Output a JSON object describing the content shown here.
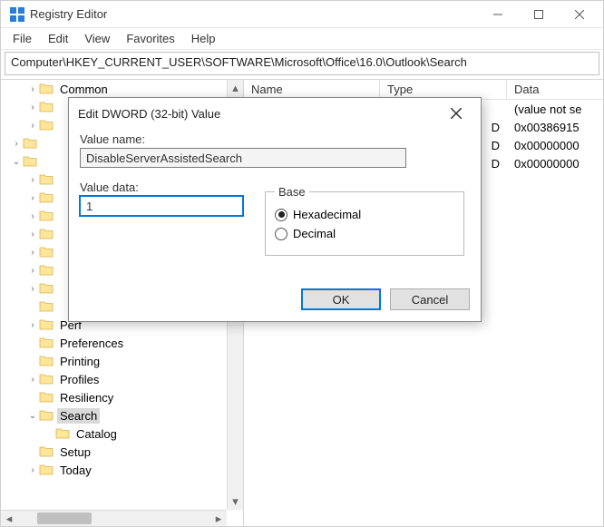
{
  "window": {
    "title": "Registry Editor"
  },
  "menu": {
    "file": "File",
    "edit": "Edit",
    "view": "View",
    "favorites": "Favorites",
    "help": "Help"
  },
  "address": "Computer\\HKEY_CURRENT_USER\\SOFTWARE\\Microsoft\\Office\\16.0\\Outlook\\Search",
  "tree": [
    {
      "depth": 1,
      "chev": "right",
      "label": "Common"
    },
    {
      "depth": 1,
      "chev": "right",
      "label": ""
    },
    {
      "depth": 1,
      "chev": "right",
      "label": ""
    },
    {
      "depth": 0,
      "chev": "right",
      "label": ""
    },
    {
      "depth": 0,
      "chev": "down",
      "label": ""
    },
    {
      "depth": 1,
      "chev": "right",
      "label": ""
    },
    {
      "depth": 1,
      "chev": "right",
      "label": ""
    },
    {
      "depth": 1,
      "chev": "right",
      "label": ""
    },
    {
      "depth": 1,
      "chev": "right",
      "label": ""
    },
    {
      "depth": 1,
      "chev": "right",
      "label": ""
    },
    {
      "depth": 1,
      "chev": "right",
      "label": ""
    },
    {
      "depth": 1,
      "chev": "right",
      "label": ""
    },
    {
      "depth": 1,
      "chev": "none",
      "label": ""
    },
    {
      "depth": 1,
      "chev": "right",
      "label": "Perf"
    },
    {
      "depth": 1,
      "chev": "none",
      "label": "Preferences"
    },
    {
      "depth": 1,
      "chev": "none",
      "label": "Printing"
    },
    {
      "depth": 1,
      "chev": "right",
      "label": "Profiles"
    },
    {
      "depth": 1,
      "chev": "none",
      "label": "Resiliency"
    },
    {
      "depth": 1,
      "chev": "down",
      "label": "Search",
      "selected": true
    },
    {
      "depth": 2,
      "chev": "none",
      "label": "Catalog"
    },
    {
      "depth": 1,
      "chev": "none",
      "label": "Setup"
    },
    {
      "depth": 1,
      "chev": "right",
      "label": "Today"
    }
  ],
  "list": {
    "columns": {
      "name": "Name",
      "type": "Type",
      "data": "Data"
    },
    "col_widths": {
      "name": 150,
      "type": 140,
      "data": 120
    },
    "rows": [
      {
        "name": "",
        "type": "",
        "data": "(value not se"
      },
      {
        "name": "",
        "type": "D",
        "data": "0x00386915"
      },
      {
        "name": "",
        "type": "D",
        "data": "0x00000000"
      },
      {
        "name": "",
        "type": "D",
        "data": "0x00000000"
      }
    ]
  },
  "dialog": {
    "title": "Edit DWORD (32-bit) Value",
    "value_name_label": "Value name:",
    "value_name": "DisableServerAssistedSearch",
    "value_data_label": "Value data:",
    "value_data": "1",
    "base_label": "Base",
    "radio_hex": "Hexadecimal",
    "radio_dec": "Decimal",
    "ok": "OK",
    "cancel": "Cancel"
  }
}
